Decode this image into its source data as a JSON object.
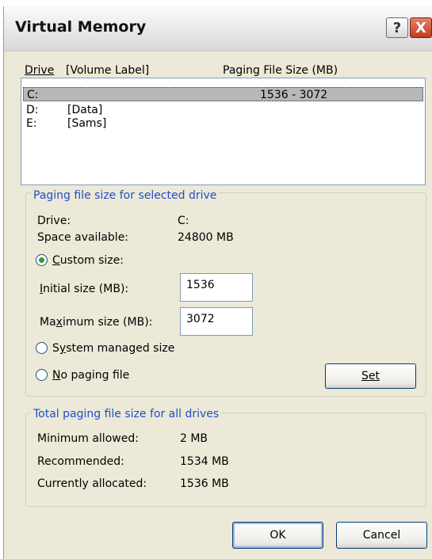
{
  "window": {
    "title": "Virtual Memory",
    "help_label": "?",
    "close_label": "X"
  },
  "drive_list": {
    "header_drive": "Drive",
    "header_volume": "[Volume Label]",
    "header_paging": "Paging File Size (MB)",
    "rows": [
      {
        "drive": "C:",
        "label": "",
        "size": "1536 - 3072",
        "selected": true
      },
      {
        "drive": "D:",
        "label": "[Data]",
        "size": ""
      },
      {
        "drive": "E:",
        "label": "[Sams]",
        "size": ""
      }
    ]
  },
  "selected_drive": {
    "legend": "Paging file size for selected drive",
    "drive_label": "Drive:",
    "drive_value": "C:",
    "space_label": "Space available:",
    "space_value": "24800 MB",
    "custom_size_label": "Custom size:",
    "initial_label": "Initial size (MB):",
    "initial_value": "1536",
    "maximum_label": "Maximum size (MB):",
    "maximum_value": "3072",
    "system_managed_label": "System managed size",
    "no_paging_label": "No paging file",
    "set_label": "Set",
    "selected_option": "custom"
  },
  "totals": {
    "legend": "Total paging file size for all drives",
    "minimum_label": "Minimum allowed:",
    "minimum_value": "2 MB",
    "recommended_label": "Recommended:",
    "recommended_value": "1534 MB",
    "allocated_label": "Currently allocated:",
    "allocated_value": "1536 MB"
  },
  "buttons": {
    "ok": "OK",
    "cancel": "Cancel"
  }
}
